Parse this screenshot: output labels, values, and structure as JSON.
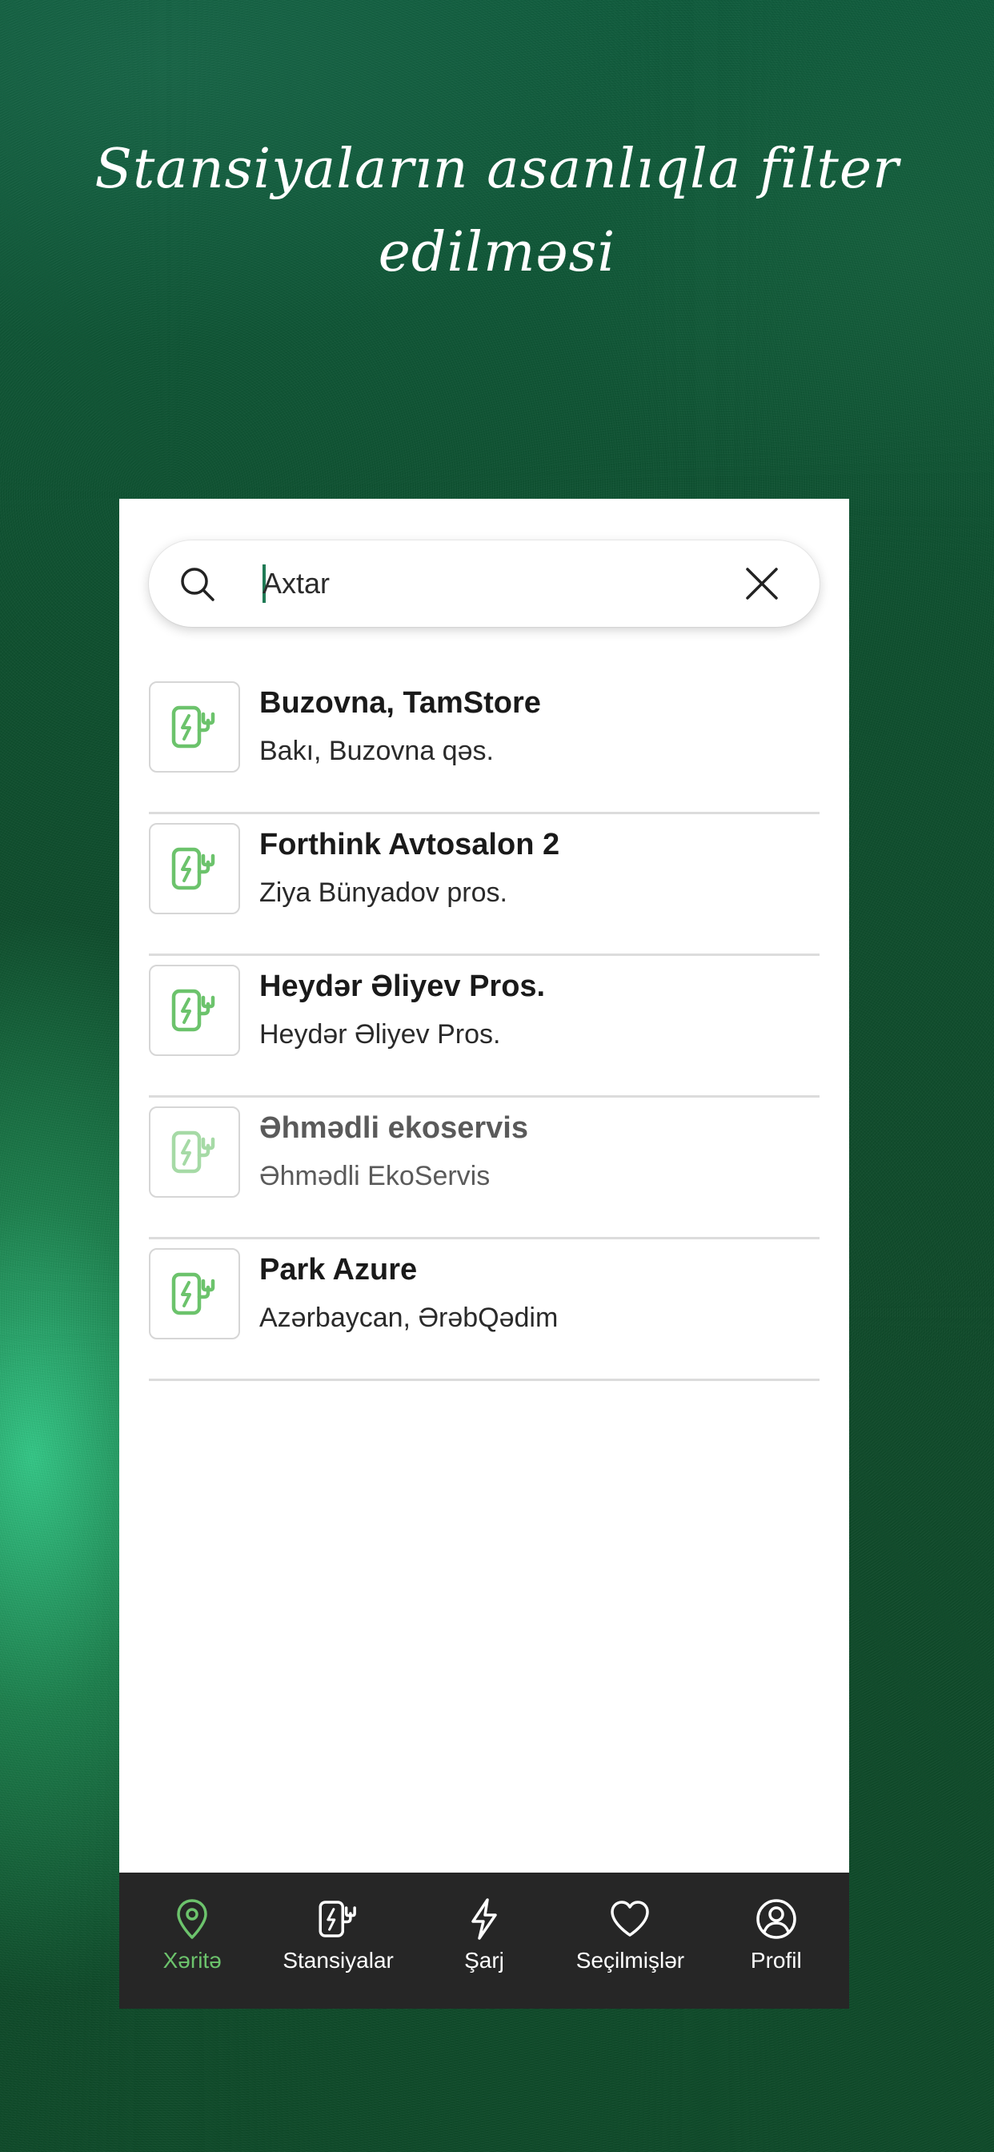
{
  "promo": {
    "headline": "Stansiyaların asanlıqla filter edilməsi"
  },
  "search": {
    "placeholder": "Axtar",
    "value": ""
  },
  "stations": [
    {
      "name": "Buzovna, TamStore",
      "address": "Bakı, Buzovna qəs.",
      "dimmed": false
    },
    {
      "name": "Forthink Avtosalon 2",
      "address": "Ziya Bünyadov pros.",
      "dimmed": false
    },
    {
      "name": "Heydər Əliyev Pros.",
      "address": "Heydər Əliyev Pros.",
      "dimmed": false
    },
    {
      "name": "Əhmədli ekoservis",
      "address": "Əhmədli EkoServis",
      "dimmed": true
    },
    {
      "name": "Park Azure",
      "address": "Azərbaycan, ƏrəbQədim",
      "dimmed": false
    }
  ],
  "tabbar": {
    "items": [
      {
        "label": "Xəritə",
        "icon": "map-pin-icon",
        "active": true
      },
      {
        "label": "Stansiyalar",
        "icon": "charging-station-icon",
        "active": false
      },
      {
        "label": "Şarj",
        "icon": "lightning-icon",
        "active": false
      },
      {
        "label": "Seçilmişlər",
        "icon": "heart-icon",
        "active": false
      },
      {
        "label": "Profil",
        "icon": "profile-icon",
        "active": false
      }
    ]
  },
  "colors": {
    "accent": "#6cc36c",
    "tabbar_bg": "#262626",
    "background": "#0e4f2e"
  }
}
